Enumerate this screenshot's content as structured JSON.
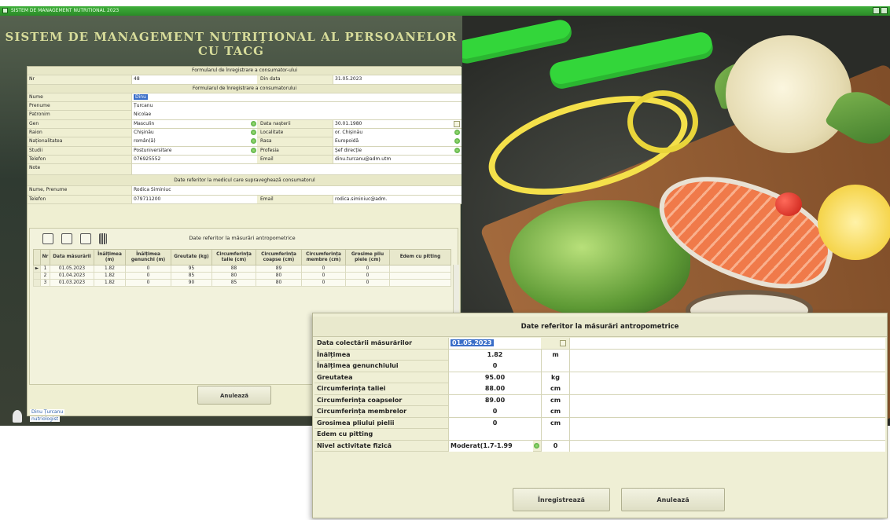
{
  "window": {
    "title": "SISTEM DE MANAGEMENT NUTRITIONAL 2023",
    "app_heading": "SISTEM DE MANAGEMENT NUTRIŢIONAL AL PERSOANELOR CU TACG"
  },
  "form": {
    "header_consumer": "Formularul de înregistrare a consumator-ului",
    "nr_label": "Nr",
    "nr_value": "48",
    "din_data_label": "Din data",
    "din_data_value": "31.05.2023",
    "header_consumer2": "Formularul de înregistrare a consumatorului",
    "nume_label": "Nume",
    "nume_value": "Dinu",
    "prenume_label": "Prenume",
    "prenume_value": "Țurcanu",
    "patronim_label": "Patronim",
    "patronim_value": "Nicolae",
    "gen_label": "Gen",
    "gen_value": "Masculin",
    "data_nasterii_label": "Data nașterii",
    "data_nasterii_value": "30.01.1980",
    "raion_label": "Raion",
    "raion_value": "Chișinău",
    "localitate_label": "Localitate",
    "localitate_value": "or. Chișinău",
    "nationalitate_label": "Naționalitatea",
    "nationalitate_value": "român(ă)",
    "rasa_label": "Rasa",
    "rasa_value": "Europoidă",
    "studii_label": "Studii",
    "studii_value": "Postuniversitare",
    "profesia_label": "Profesia",
    "profesia_value": "Șef direcție",
    "telefon_label": "Telefon",
    "telefon_value": "076925552",
    "email_label": "Email",
    "email_value": "dinu.turcanu@adm.utm",
    "note_label": "Note",
    "header_medic": "Date referitor la medicul care supraveghează consumatorul",
    "medic_nume_label": "Nume, Prenume",
    "medic_nume_value": "Rodica Siminiuc",
    "medic_telefon_label": "Telefon",
    "medic_telefon_value": "079711200",
    "medic_email_label": "Email",
    "medic_email_value": "rodica.siminiuc@adm."
  },
  "measurements": {
    "title": "Date referitor la măsurări antropometrice",
    "columns": [
      "Nr",
      "Data măsurării",
      "Înălțimea (m)",
      "Înălțimea genunchi (m)",
      "Greutate (kg)",
      "Circumferința talie (cm)",
      "Circumferința coapse (cm)",
      "Circumferința membre (cm)",
      "Grosime pliu piele (cm)",
      "Edem cu pitting"
    ],
    "rows": [
      [
        "1",
        "01.05.2023",
        "1.82",
        "0",
        "95",
        "88",
        "89",
        "0",
        "0",
        ""
      ],
      [
        "2",
        "01.04.2023",
        "1.82",
        "0",
        "85",
        "80",
        "80",
        "0",
        "0",
        ""
      ],
      [
        "3",
        "01.03.2023",
        "1.82",
        "0",
        "90",
        "85",
        "80",
        "0",
        "0",
        ""
      ]
    ],
    "cancel_label": "Anulează"
  },
  "status": {
    "line1": "Dinu Țurcanu",
    "line2": "nutriologist"
  },
  "dialog": {
    "title": "Date referitor la măsurări antropometrice",
    "fields": [
      {
        "label": "Data colectării măsurărilor",
        "value": "01.05.2023",
        "unit": ""
      },
      {
        "label": "Înălțimea",
        "value": "1.82",
        "unit": "m"
      },
      {
        "label": "Înălțimea genunchiului",
        "value": "0",
        "unit": ""
      },
      {
        "label": "Greutatea",
        "value": "95.00",
        "unit": "kg"
      },
      {
        "label": "Circumferința taliei",
        "value": "88.00",
        "unit": "cm"
      },
      {
        "label": "Circumferința coapselor",
        "value": "89.00",
        "unit": "cm"
      },
      {
        "label": "Circumferința membrelor",
        "value": "0",
        "unit": "cm"
      },
      {
        "label": "Grosimea pliului pielii",
        "value": "0",
        "unit": "cm"
      },
      {
        "label": "Edem cu pitting",
        "value": "",
        "unit": ""
      },
      {
        "label": "Nivel activitate fizică",
        "value": "Moderat(1.7-1.99",
        "unit": "0"
      }
    ],
    "save_label": "Înregistrează",
    "cancel_label": "Anulează"
  },
  "colors": {
    "titlebar": "#3fae3a",
    "form_bg": "#efefd2",
    "selection": "#3a6ec8",
    "heading": "#d7dc9a"
  }
}
